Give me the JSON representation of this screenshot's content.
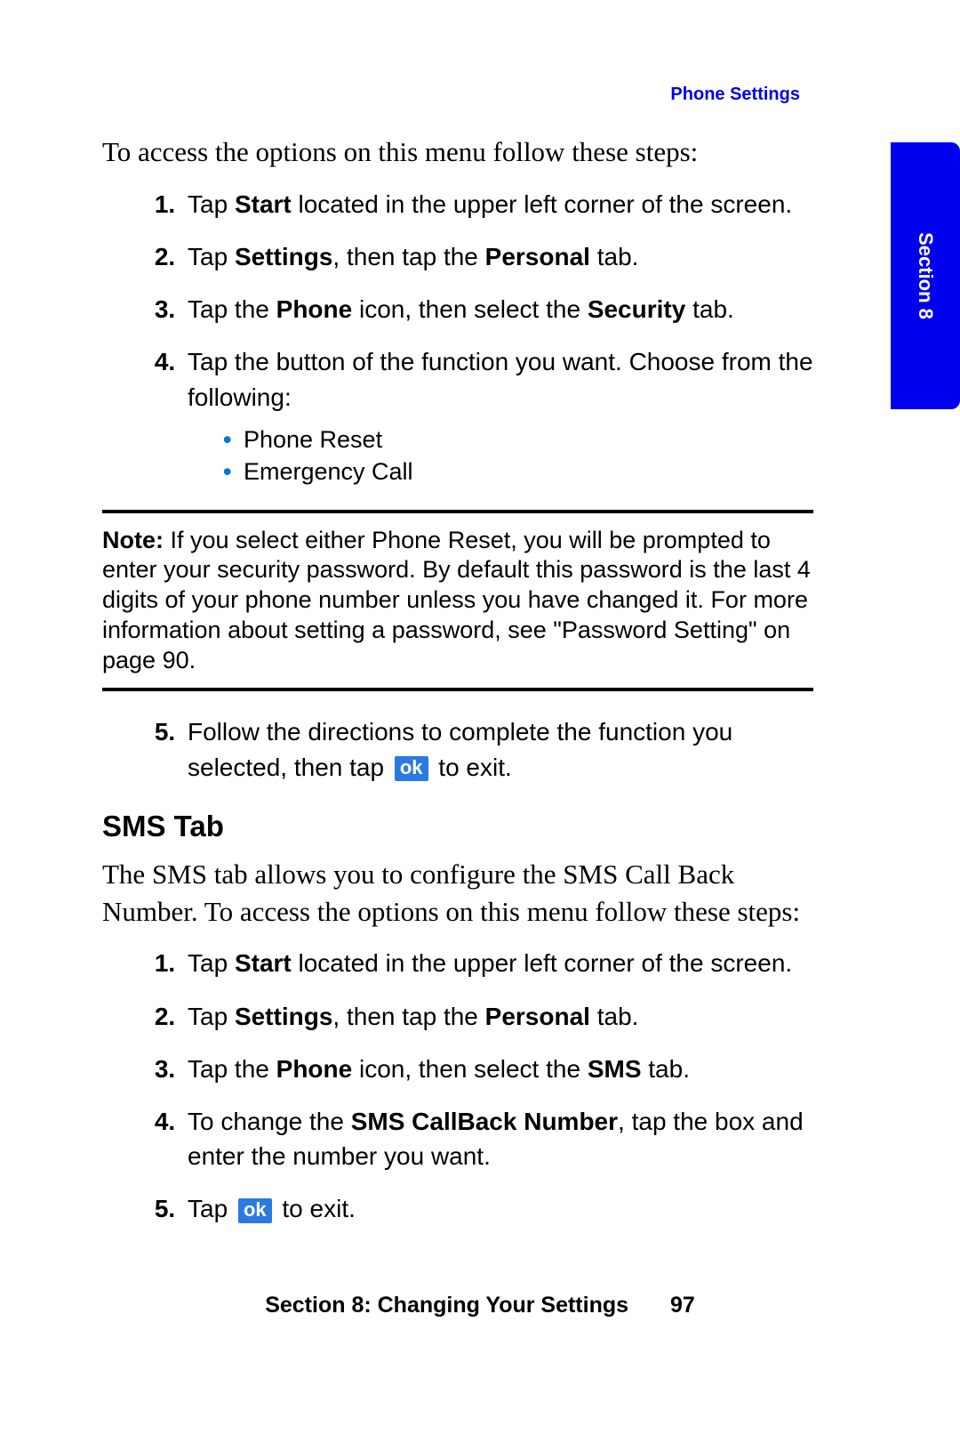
{
  "header": {
    "label": "Phone Settings"
  },
  "tab": {
    "label": "Section 8"
  },
  "intro1": "To access the options on this menu follow these steps:",
  "steps1": {
    "s1_pre": "Tap ",
    "s1_b1": "Start",
    "s1_post": " located in the upper left corner of the screen.",
    "s2_pre": "Tap ",
    "s2_b1": "Settings",
    "s2_mid": ", then tap the ",
    "s2_b2": "Personal",
    "s2_post": " tab.",
    "s3_pre": "Tap the ",
    "s3_b1": "Phone",
    "s3_mid": " icon, then select the ",
    "s3_b2": "Security",
    "s3_post": " tab.",
    "s4": "Tap the button of the function you want. Choose from the following:",
    "sub1": "Phone Reset",
    "sub2": "Emergency Call",
    "s5_pre": "Follow the directions to complete the function you selected, then tap ",
    "s5_post": " to exit."
  },
  "note": {
    "label": "Note:",
    "text": " If you select either Phone Reset, you will be prompted to enter your security password. By default this password is the last 4 digits of your phone number unless you have changed it. For more information about setting a password, see \"Password Setting\" on page 90."
  },
  "heading_sms": "SMS Tab",
  "intro2": "The SMS tab allows you to configure the SMS Call Back Number. To access the options on this menu follow these steps:",
  "steps2": {
    "s1_pre": "Tap ",
    "s1_b1": "Start",
    "s1_post": " located in the upper left corner of the screen.",
    "s2_pre": "Tap ",
    "s2_b1": "Settings",
    "s2_mid": ", then tap the ",
    "s2_b2": "Personal",
    "s2_post": " tab.",
    "s3_pre": "Tap the ",
    "s3_b1": "Phone",
    "s3_mid": " icon, then select the ",
    "s3_b2": "SMS",
    "s3_post": " tab.",
    "s4_pre": "To change the ",
    "s4_b1": "SMS CallBack Number",
    "s4_post": ", tap the box and enter the number you want.",
    "s5_pre": "Tap ",
    "s5_post": " to exit."
  },
  "ok_label": "ok",
  "footer": {
    "section": "Section 8: Changing Your Settings",
    "page": "97"
  }
}
